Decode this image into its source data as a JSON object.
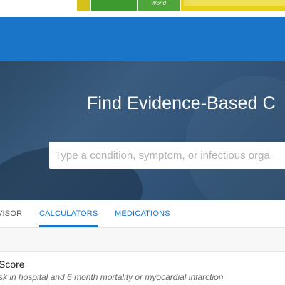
{
  "ad": {
    "word": "World"
  },
  "hero": {
    "title": "Find Evidence-Based C",
    "search_placeholder": "Type a condition, symptom, or infectious orga"
  },
  "tabs": [
    {
      "label": "VISOR"
    },
    {
      "label": "CALCULATORS"
    },
    {
      "label": "MEDICATIONS"
    }
  ],
  "active_tab": "CALCULATORS",
  "result": {
    "title": "Score",
    "description": "sk in hospital and 6 month mortality or myocardial infarction"
  },
  "colors": {
    "brand_blue": "#1a74c8",
    "hero_dark": "#2c4a68",
    "ad_yellow": "#e8d11a",
    "ad_green": "#3c9a2e"
  }
}
